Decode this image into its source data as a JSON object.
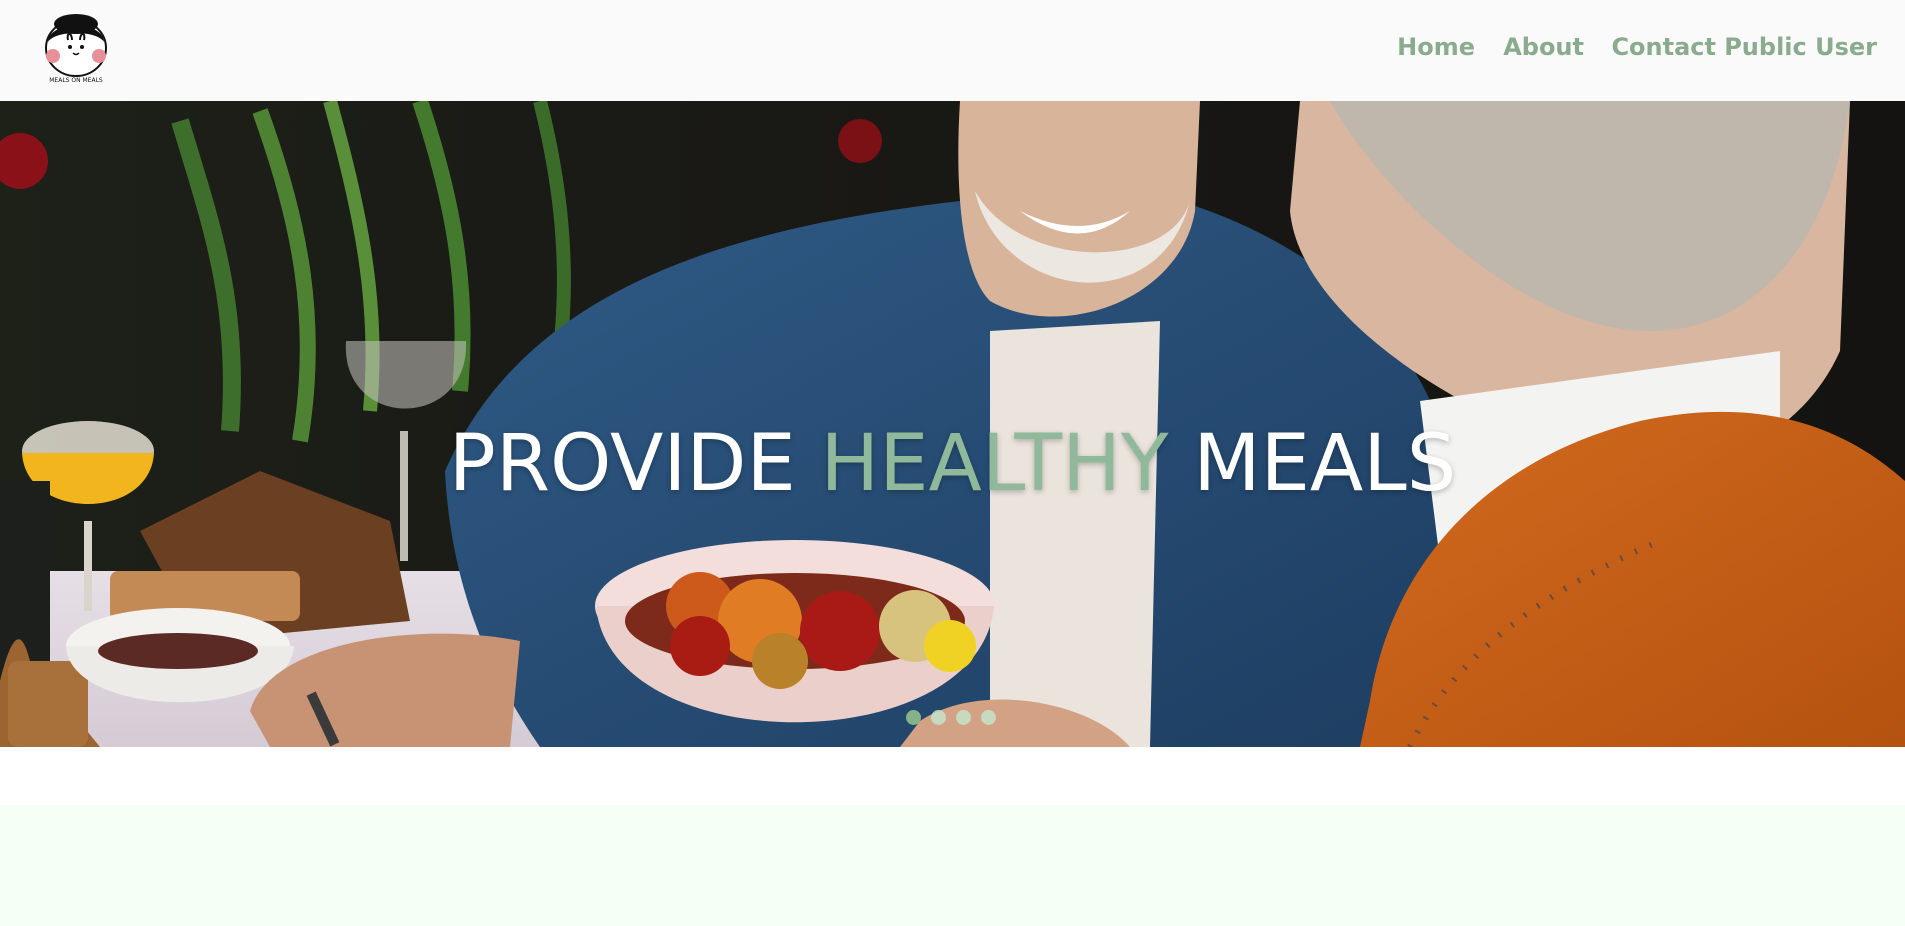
{
  "brand": {
    "logo_icon": "mascot-logo-icon",
    "logo_caption": "MEALS ON MEALS"
  },
  "nav": {
    "items": [
      {
        "label": "Home"
      },
      {
        "label": "About"
      },
      {
        "label": "Contact"
      },
      {
        "label": "Public User"
      }
    ],
    "color": "#8aab8d"
  },
  "hero": {
    "title_part1": "PROVIDE",
    "title_accent": "HEALTHY",
    "title_part2": "MEALS",
    "accent_color": "#8fb99a",
    "carousel": {
      "slide_count": 4,
      "active_index": 0
    }
  },
  "colors": {
    "page_bottom_band": "#f5fff5",
    "navbar_bg": "#fafafa"
  }
}
